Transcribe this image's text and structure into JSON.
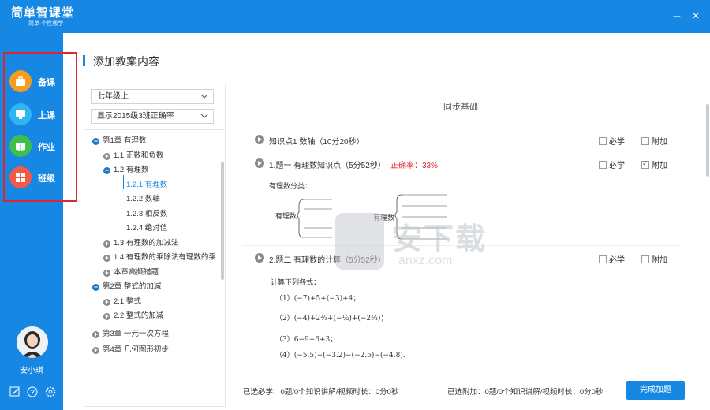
{
  "app": {
    "logo_text": "简单智课堂",
    "logo_sub": "简单·个性教学"
  },
  "window": {
    "minimize": "–",
    "close": "×"
  },
  "sidebar": {
    "items": [
      {
        "label": "备课",
        "icon": "briefcase-icon",
        "color": "#f59b1e"
      },
      {
        "label": "上课",
        "icon": "monitor-icon",
        "color": "#2fb6f0"
      },
      {
        "label": "作业",
        "icon": "book-icon",
        "color": "#3cbf4b"
      },
      {
        "label": "班级",
        "icon": "grid-icon",
        "color": "#f25a48"
      }
    ],
    "user_name": "安小琪",
    "tools": [
      "edit-icon",
      "help-icon",
      "settings-icon"
    ]
  },
  "page": {
    "title": "添加教案内容"
  },
  "filters": {
    "grade": "七年级上",
    "display": "显示2015级3班正确率"
  },
  "tree": [
    {
      "label": "第1章  有理数",
      "toggle": "−",
      "open": true
    },
    {
      "label": "1.1 正数和负数",
      "toggle": "+"
    },
    {
      "label": "1.2 有理数",
      "toggle": "−",
      "open": true
    },
    {
      "label": "1.2.1 有理数",
      "selected": true
    },
    {
      "label": "1.2.2 数轴"
    },
    {
      "label": "1.2.3 相反数"
    },
    {
      "label": "1.2.4 绝对值"
    },
    {
      "label": "1.3 有理数的加减法",
      "toggle": "+"
    },
    {
      "label": "1.4 有理数的乘除法有理数的乘...",
      "toggle": "+"
    },
    {
      "label": "本章高频错题",
      "toggle": "+"
    },
    {
      "label": "第2章  整式的加减",
      "toggle": "−",
      "open": true
    },
    {
      "label": "2.1 整式",
      "toggle": "+"
    },
    {
      "label": "2.2 整式的加减",
      "toggle": "+"
    },
    {
      "label": "第3章  一元一次方程",
      "toggle": "+"
    },
    {
      "label": "第4章  几何图形初步",
      "toggle": "+"
    }
  ],
  "content": {
    "section_title": "同步基础",
    "required_label": "必学",
    "extra_label": "附加",
    "rows": [
      {
        "text": "知识点1   数轴（10分20秒）",
        "rate": "",
        "required": false,
        "extra": false
      },
      {
        "text": "1.题一   有理数知识点（5分52秒）",
        "rate": "正确率：33%",
        "required": false,
        "extra": true
      },
      {
        "text": "2.题二   有理数的计算（5分52秒）",
        "rate": "",
        "required": false,
        "extra": false
      }
    ],
    "q1_lines": [
      "有理数分类：",
      "有理数",
      "有理数"
    ],
    "q2_title": "计算下列各式：",
    "q2_lines": [
      "（1）(−7)+5+(−3)+4；",
      "（2）(−4)+2⅔+(−½)+(−2⅔)；",
      "（3）6−9−6+3；",
      "（4）(−5.5)−(−3.2)−(−2.5)−(−4.8)."
    ]
  },
  "footer": {
    "required_summary": "已选必学：0题/0个知识讲解/视频时长：0分0秒",
    "extra_summary": "已选附加：0题/0个知识讲解/视频时长：0分0秒",
    "finish_button": "完成加题"
  },
  "watermark": {
    "text": "安下载",
    "sub": "anxz.com"
  },
  "colors": {
    "brand": "#1688e4",
    "highlight_box": "#e0262a",
    "rate": "#e0262a"
  }
}
